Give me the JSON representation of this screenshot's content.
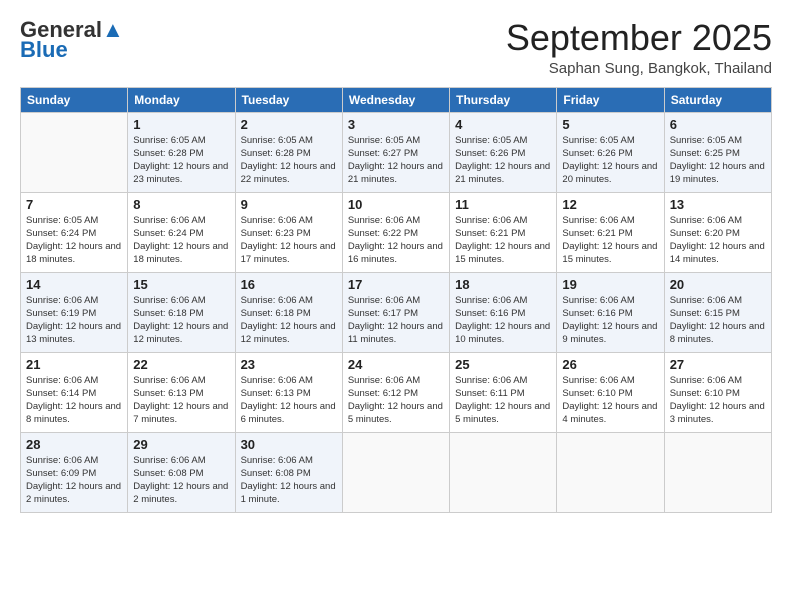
{
  "logo": {
    "text_general": "General",
    "text_blue": "Blue"
  },
  "header": {
    "month_year": "September 2025",
    "location": "Saphan Sung, Bangkok, Thailand"
  },
  "weekdays": [
    "Sunday",
    "Monday",
    "Tuesday",
    "Wednesday",
    "Thursday",
    "Friday",
    "Saturday"
  ],
  "weeks": [
    [
      {
        "day": "",
        "sunrise": "",
        "sunset": "",
        "daylight": ""
      },
      {
        "day": "1",
        "sunrise": "Sunrise: 6:05 AM",
        "sunset": "Sunset: 6:28 PM",
        "daylight": "Daylight: 12 hours and 23 minutes."
      },
      {
        "day": "2",
        "sunrise": "Sunrise: 6:05 AM",
        "sunset": "Sunset: 6:28 PM",
        "daylight": "Daylight: 12 hours and 22 minutes."
      },
      {
        "day": "3",
        "sunrise": "Sunrise: 6:05 AM",
        "sunset": "Sunset: 6:27 PM",
        "daylight": "Daylight: 12 hours and 21 minutes."
      },
      {
        "day": "4",
        "sunrise": "Sunrise: 6:05 AM",
        "sunset": "Sunset: 6:26 PM",
        "daylight": "Daylight: 12 hours and 21 minutes."
      },
      {
        "day": "5",
        "sunrise": "Sunrise: 6:05 AM",
        "sunset": "Sunset: 6:26 PM",
        "daylight": "Daylight: 12 hours and 20 minutes."
      },
      {
        "day": "6",
        "sunrise": "Sunrise: 6:05 AM",
        "sunset": "Sunset: 6:25 PM",
        "daylight": "Daylight: 12 hours and 19 minutes."
      }
    ],
    [
      {
        "day": "7",
        "sunrise": "Sunrise: 6:05 AM",
        "sunset": "Sunset: 6:24 PM",
        "daylight": "Daylight: 12 hours and 18 minutes."
      },
      {
        "day": "8",
        "sunrise": "Sunrise: 6:06 AM",
        "sunset": "Sunset: 6:24 PM",
        "daylight": "Daylight: 12 hours and 18 minutes."
      },
      {
        "day": "9",
        "sunrise": "Sunrise: 6:06 AM",
        "sunset": "Sunset: 6:23 PM",
        "daylight": "Daylight: 12 hours and 17 minutes."
      },
      {
        "day": "10",
        "sunrise": "Sunrise: 6:06 AM",
        "sunset": "Sunset: 6:22 PM",
        "daylight": "Daylight: 12 hours and 16 minutes."
      },
      {
        "day": "11",
        "sunrise": "Sunrise: 6:06 AM",
        "sunset": "Sunset: 6:21 PM",
        "daylight": "Daylight: 12 hours and 15 minutes."
      },
      {
        "day": "12",
        "sunrise": "Sunrise: 6:06 AM",
        "sunset": "Sunset: 6:21 PM",
        "daylight": "Daylight: 12 hours and 15 minutes."
      },
      {
        "day": "13",
        "sunrise": "Sunrise: 6:06 AM",
        "sunset": "Sunset: 6:20 PM",
        "daylight": "Daylight: 12 hours and 14 minutes."
      }
    ],
    [
      {
        "day": "14",
        "sunrise": "Sunrise: 6:06 AM",
        "sunset": "Sunset: 6:19 PM",
        "daylight": "Daylight: 12 hours and 13 minutes."
      },
      {
        "day": "15",
        "sunrise": "Sunrise: 6:06 AM",
        "sunset": "Sunset: 6:18 PM",
        "daylight": "Daylight: 12 hours and 12 minutes."
      },
      {
        "day": "16",
        "sunrise": "Sunrise: 6:06 AM",
        "sunset": "Sunset: 6:18 PM",
        "daylight": "Daylight: 12 hours and 12 minutes."
      },
      {
        "day": "17",
        "sunrise": "Sunrise: 6:06 AM",
        "sunset": "Sunset: 6:17 PM",
        "daylight": "Daylight: 12 hours and 11 minutes."
      },
      {
        "day": "18",
        "sunrise": "Sunrise: 6:06 AM",
        "sunset": "Sunset: 6:16 PM",
        "daylight": "Daylight: 12 hours and 10 minutes."
      },
      {
        "day": "19",
        "sunrise": "Sunrise: 6:06 AM",
        "sunset": "Sunset: 6:16 PM",
        "daylight": "Daylight: 12 hours and 9 minutes."
      },
      {
        "day": "20",
        "sunrise": "Sunrise: 6:06 AM",
        "sunset": "Sunset: 6:15 PM",
        "daylight": "Daylight: 12 hours and 8 minutes."
      }
    ],
    [
      {
        "day": "21",
        "sunrise": "Sunrise: 6:06 AM",
        "sunset": "Sunset: 6:14 PM",
        "daylight": "Daylight: 12 hours and 8 minutes."
      },
      {
        "day": "22",
        "sunrise": "Sunrise: 6:06 AM",
        "sunset": "Sunset: 6:13 PM",
        "daylight": "Daylight: 12 hours and 7 minutes."
      },
      {
        "day": "23",
        "sunrise": "Sunrise: 6:06 AM",
        "sunset": "Sunset: 6:13 PM",
        "daylight": "Daylight: 12 hours and 6 minutes."
      },
      {
        "day": "24",
        "sunrise": "Sunrise: 6:06 AM",
        "sunset": "Sunset: 6:12 PM",
        "daylight": "Daylight: 12 hours and 5 minutes."
      },
      {
        "day": "25",
        "sunrise": "Sunrise: 6:06 AM",
        "sunset": "Sunset: 6:11 PM",
        "daylight": "Daylight: 12 hours and 5 minutes."
      },
      {
        "day": "26",
        "sunrise": "Sunrise: 6:06 AM",
        "sunset": "Sunset: 6:10 PM",
        "daylight": "Daylight: 12 hours and 4 minutes."
      },
      {
        "day": "27",
        "sunrise": "Sunrise: 6:06 AM",
        "sunset": "Sunset: 6:10 PM",
        "daylight": "Daylight: 12 hours and 3 minutes."
      }
    ],
    [
      {
        "day": "28",
        "sunrise": "Sunrise: 6:06 AM",
        "sunset": "Sunset: 6:09 PM",
        "daylight": "Daylight: 12 hours and 2 minutes."
      },
      {
        "day": "29",
        "sunrise": "Sunrise: 6:06 AM",
        "sunset": "Sunset: 6:08 PM",
        "daylight": "Daylight: 12 hours and 2 minutes."
      },
      {
        "day": "30",
        "sunrise": "Sunrise: 6:06 AM",
        "sunset": "Sunset: 6:08 PM",
        "daylight": "Daylight: 12 hours and 1 minute."
      },
      {
        "day": "",
        "sunrise": "",
        "sunset": "",
        "daylight": ""
      },
      {
        "day": "",
        "sunrise": "",
        "sunset": "",
        "daylight": ""
      },
      {
        "day": "",
        "sunrise": "",
        "sunset": "",
        "daylight": ""
      },
      {
        "day": "",
        "sunrise": "",
        "sunset": "",
        "daylight": ""
      }
    ]
  ]
}
